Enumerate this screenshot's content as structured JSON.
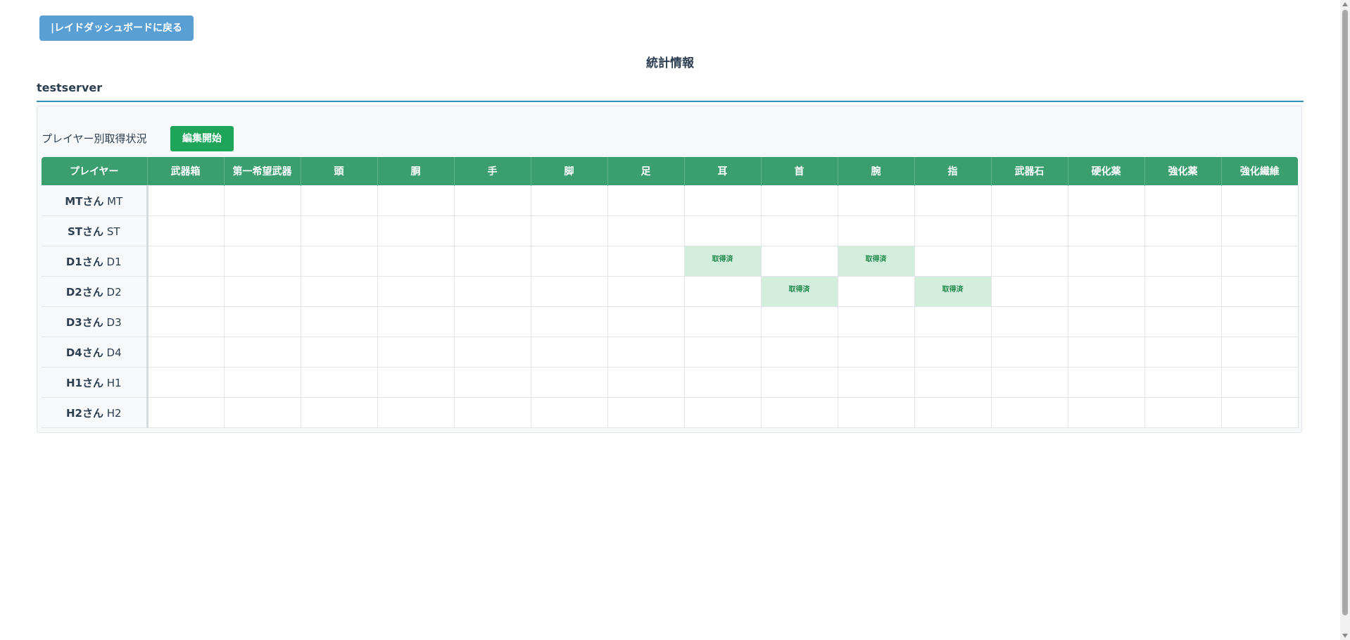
{
  "back_button_label": "|レイドダッシュボードに戻る",
  "page_title": "統計情報",
  "server_name": "testserver",
  "section_label": "プレイヤー別取得状況",
  "edit_button_label": "編集開始",
  "table": {
    "player_header": "プレイヤー",
    "columns": [
      "武器箱",
      "第一希望武器",
      "頭",
      "胴",
      "手",
      "脚",
      "足",
      "耳",
      "首",
      "腕",
      "指",
      "武器石",
      "硬化薬",
      "強化薬",
      "強化繊維"
    ],
    "obtained_label": "取得済",
    "rows": [
      {
        "name": "MTさん",
        "role": "MT",
        "obtained": []
      },
      {
        "name": "STさん",
        "role": "ST",
        "obtained": []
      },
      {
        "name": "D1さん",
        "role": "D1",
        "obtained": [
          "耳",
          "腕"
        ]
      },
      {
        "name": "D2さん",
        "role": "D2",
        "obtained": [
          "首",
          "指"
        ]
      },
      {
        "name": "D3さん",
        "role": "D3",
        "obtained": []
      },
      {
        "name": "D4さん",
        "role": "D4",
        "obtained": []
      },
      {
        "name": "H1さん",
        "role": "H1",
        "obtained": []
      },
      {
        "name": "H2さん",
        "role": "H2",
        "obtained": []
      }
    ]
  },
  "colors": {
    "header_green": "#3a9e6e",
    "edit_button_green": "#1fa55a",
    "back_button_blue": "#5a9fd4",
    "obtained_cell": "#d4eedd",
    "server_rule": "#2e8fc8"
  }
}
